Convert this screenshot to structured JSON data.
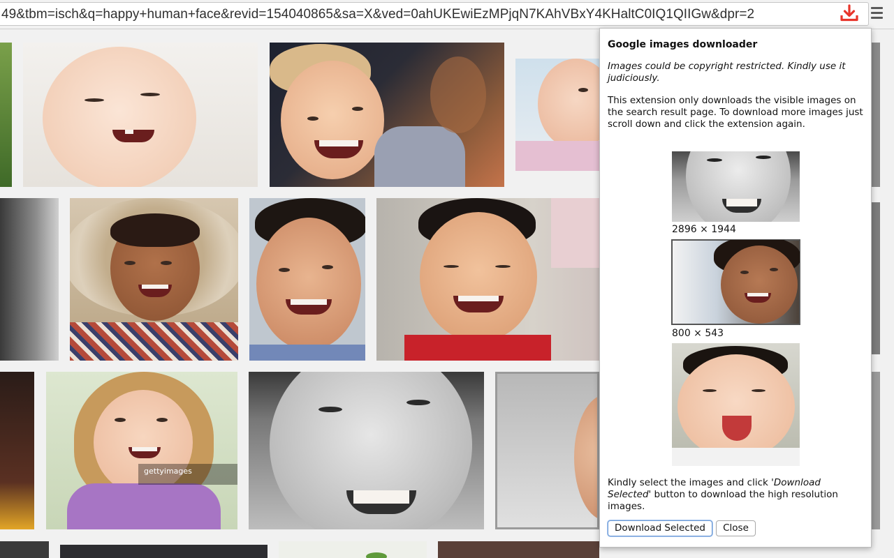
{
  "browser": {
    "url": "49&tbm=isch&q=happy+human+face&revid=154040865&sa=X&ved=0ahUKEwiEzMPjqN7KAhVBxY4KHaltC0IQ1QIIGw&dpr=2",
    "extension_icon": "download-arrow-icon",
    "menu_icon": "hamburger-menu-icon",
    "accent_color": "#e8352b"
  },
  "results": {
    "watermark_text": "gettyimages"
  },
  "popup": {
    "title": "Google images downloader",
    "warning": "Images could be copyright restricted. Kindly use it judiciously.",
    "info": "This extension only downloads the visible images on the search result page. To download more images just scroll down and click the extension again.",
    "images": [
      {
        "size": "2896 × 1944",
        "selected": false
      },
      {
        "size": "800 × 543",
        "selected": true
      },
      {
        "size": "",
        "selected": false
      }
    ],
    "instructions_prefix": "Kindly select the images and click ",
    "instructions_emph": "'Download Selected'",
    "instructions_suffix": " button to download the high resolution images.",
    "download_button": "Download Selected",
    "close_button": "Close"
  }
}
